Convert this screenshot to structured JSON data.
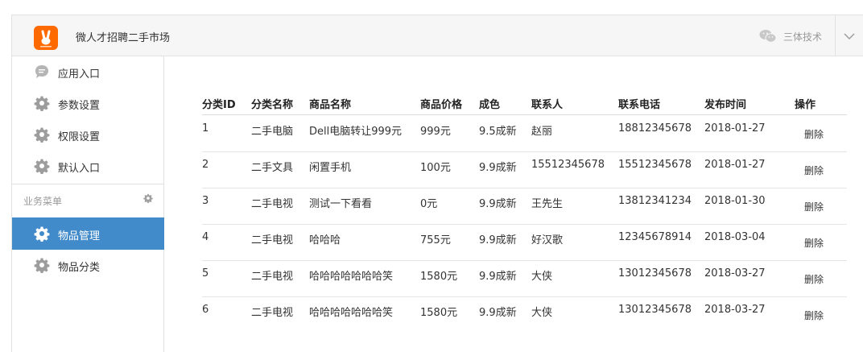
{
  "header": {
    "app_title": "微人才招聘二手市场",
    "account_name": "三体技术",
    "logo_icon": "peace-hand-icon",
    "brand_color": "#ff6a00"
  },
  "sidebar": {
    "items": [
      {
        "label": "应用入口",
        "icon": "chat-bubble-icon"
      },
      {
        "label": "参数设置",
        "icon": "gear-icon"
      },
      {
        "label": "权限设置",
        "icon": "gear-icon"
      },
      {
        "label": "默认入口",
        "icon": "gear-icon"
      }
    ],
    "group_label": "业务菜单",
    "group_items": [
      {
        "label": "物品管理",
        "icon": "gear-icon",
        "active": true
      },
      {
        "label": "物品分类",
        "icon": "gear-icon",
        "active": false
      }
    ],
    "active_color": "#428bca"
  },
  "table": {
    "headers": [
      "分类ID",
      "分类名称",
      "商品名称",
      "商品价格",
      "成色",
      "联系人",
      "联系电话",
      "发布时间",
      "操作"
    ],
    "delete_label": "删除",
    "rows": [
      [
        "1",
        "二手电脑",
        "Dell电脑转让999元",
        "999元",
        "9.5成新",
        "赵丽",
        "18812345678",
        "2018-01-27"
      ],
      [
        "2",
        "二手文具",
        "闲置手机",
        "100元",
        "9.9成新",
        "15512345678",
        "15512345678",
        "2018-01-27"
      ],
      [
        "3",
        "二手电视",
        "测试一下看看",
        "0元",
        "9.9成新",
        "王先生",
        "13812341234",
        "2018-01-30"
      ],
      [
        "4",
        "二手电视",
        "哈哈哈",
        "755元",
        "9.9成新",
        "好汉歌",
        "12345678914",
        "2018-03-04"
      ],
      [
        "5",
        "二手电视",
        "哈哈哈哈哈哈哈笑",
        "1580元",
        "9.9成新",
        "大侠",
        "13012345678",
        "2018-03-27"
      ],
      [
        "6",
        "二手电视",
        "哈哈哈哈哈哈哈笑",
        "1580元",
        "9.9成新",
        "大侠",
        "13012345678",
        "2018-03-27"
      ]
    ]
  }
}
